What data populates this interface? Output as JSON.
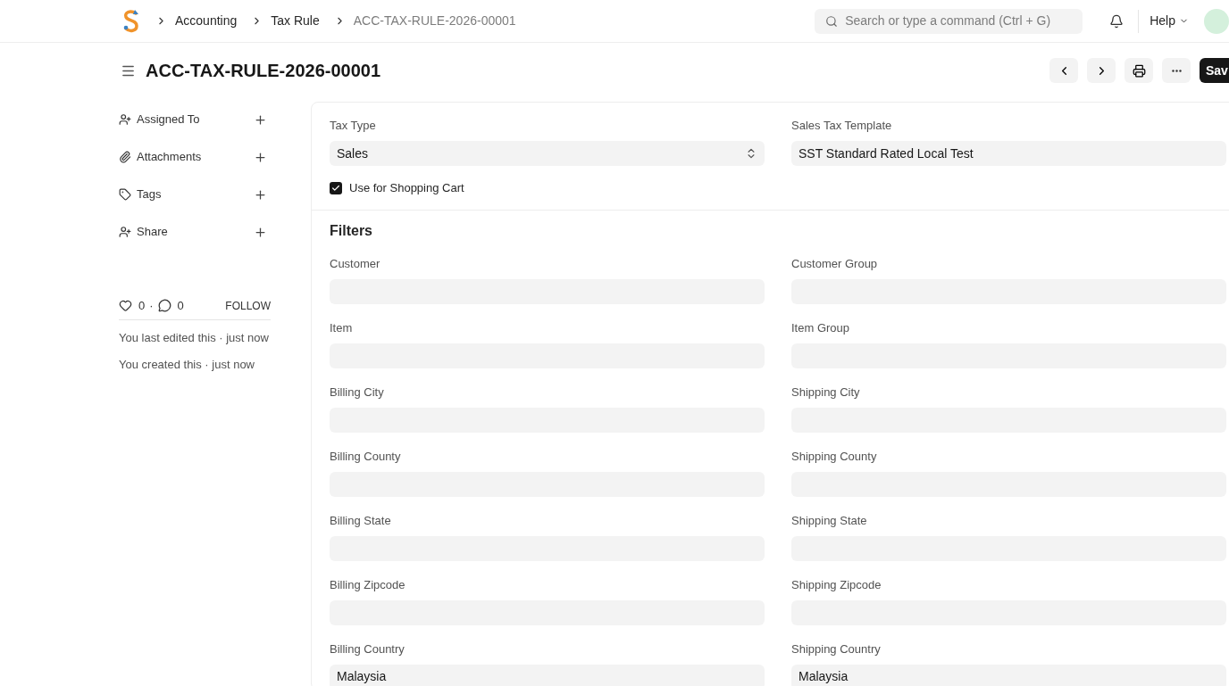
{
  "navbar": {
    "breadcrumbs": [
      "Accounting",
      "Tax Rule",
      "ACC-TAX-RULE-2026-00001"
    ],
    "search": {
      "placeholder": "Search or type a command (Ctrl + G)"
    },
    "help": "Help"
  },
  "page": {
    "title": "ACC-TAX-RULE-2026-00001",
    "save": "Sav"
  },
  "sidebar": {
    "items": [
      {
        "kind": "assign",
        "label": "Assigned To"
      },
      {
        "kind": "attach",
        "label": "Attachments"
      },
      {
        "kind": "tag",
        "label": "Tags"
      },
      {
        "kind": "share",
        "label": "Share"
      }
    ],
    "likes": "0",
    "separator": "·",
    "comments": "0",
    "follow": "FOLLOW",
    "activity": [
      "You last edited this · just now",
      "You created this · just now"
    ]
  },
  "form": {
    "top_fields": [
      {
        "kind": "select",
        "label": "Tax Type",
        "value": "Sales"
      },
      {
        "kind": "link",
        "label": "Sales Tax Template",
        "value": "SST Standard Rated Local Test"
      }
    ],
    "checkbox": {
      "label": "Use for Shopping Cart",
      "checked": true
    },
    "section": "Filters",
    "fields": [
      {
        "label": "Customer"
      },
      {
        "label": "Customer Group"
      },
      {
        "label": "Item"
      },
      {
        "label": "Item Group"
      },
      {
        "label": "Billing City"
      },
      {
        "label": "Shipping City"
      },
      {
        "label": "Billing County"
      },
      {
        "label": "Shipping County"
      },
      {
        "label": "Billing State"
      },
      {
        "label": "Shipping State"
      },
      {
        "label": "Billing Zipcode"
      },
      {
        "label": "Shipping Zipcode"
      },
      {
        "label": "Billing Country",
        "value": "Malaysia"
      },
      {
        "label": "Shipping Country",
        "value": "Malaysia"
      }
    ]
  }
}
